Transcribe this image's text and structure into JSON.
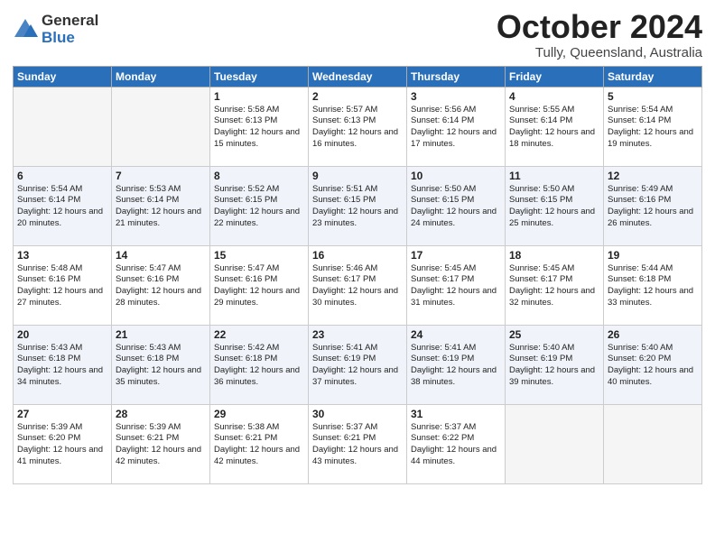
{
  "logo": {
    "general": "General",
    "blue": "Blue"
  },
  "title": "October 2024",
  "location": "Tully, Queensland, Australia",
  "days_of_week": [
    "Sunday",
    "Monday",
    "Tuesday",
    "Wednesday",
    "Thursday",
    "Friday",
    "Saturday"
  ],
  "weeks": [
    [
      {
        "day": "",
        "info": ""
      },
      {
        "day": "",
        "info": ""
      },
      {
        "day": "1",
        "info": "Sunrise: 5:58 AM\nSunset: 6:13 PM\nDaylight: 12 hours and 15 minutes."
      },
      {
        "day": "2",
        "info": "Sunrise: 5:57 AM\nSunset: 6:13 PM\nDaylight: 12 hours and 16 minutes."
      },
      {
        "day": "3",
        "info": "Sunrise: 5:56 AM\nSunset: 6:14 PM\nDaylight: 12 hours and 17 minutes."
      },
      {
        "day": "4",
        "info": "Sunrise: 5:55 AM\nSunset: 6:14 PM\nDaylight: 12 hours and 18 minutes."
      },
      {
        "day": "5",
        "info": "Sunrise: 5:54 AM\nSunset: 6:14 PM\nDaylight: 12 hours and 19 minutes."
      }
    ],
    [
      {
        "day": "6",
        "info": "Sunrise: 5:54 AM\nSunset: 6:14 PM\nDaylight: 12 hours and 20 minutes."
      },
      {
        "day": "7",
        "info": "Sunrise: 5:53 AM\nSunset: 6:14 PM\nDaylight: 12 hours and 21 minutes."
      },
      {
        "day": "8",
        "info": "Sunrise: 5:52 AM\nSunset: 6:15 PM\nDaylight: 12 hours and 22 minutes."
      },
      {
        "day": "9",
        "info": "Sunrise: 5:51 AM\nSunset: 6:15 PM\nDaylight: 12 hours and 23 minutes."
      },
      {
        "day": "10",
        "info": "Sunrise: 5:50 AM\nSunset: 6:15 PM\nDaylight: 12 hours and 24 minutes."
      },
      {
        "day": "11",
        "info": "Sunrise: 5:50 AM\nSunset: 6:15 PM\nDaylight: 12 hours and 25 minutes."
      },
      {
        "day": "12",
        "info": "Sunrise: 5:49 AM\nSunset: 6:16 PM\nDaylight: 12 hours and 26 minutes."
      }
    ],
    [
      {
        "day": "13",
        "info": "Sunrise: 5:48 AM\nSunset: 6:16 PM\nDaylight: 12 hours and 27 minutes."
      },
      {
        "day": "14",
        "info": "Sunrise: 5:47 AM\nSunset: 6:16 PM\nDaylight: 12 hours and 28 minutes."
      },
      {
        "day": "15",
        "info": "Sunrise: 5:47 AM\nSunset: 6:16 PM\nDaylight: 12 hours and 29 minutes."
      },
      {
        "day": "16",
        "info": "Sunrise: 5:46 AM\nSunset: 6:17 PM\nDaylight: 12 hours and 30 minutes."
      },
      {
        "day": "17",
        "info": "Sunrise: 5:45 AM\nSunset: 6:17 PM\nDaylight: 12 hours and 31 minutes."
      },
      {
        "day": "18",
        "info": "Sunrise: 5:45 AM\nSunset: 6:17 PM\nDaylight: 12 hours and 32 minutes."
      },
      {
        "day": "19",
        "info": "Sunrise: 5:44 AM\nSunset: 6:18 PM\nDaylight: 12 hours and 33 minutes."
      }
    ],
    [
      {
        "day": "20",
        "info": "Sunrise: 5:43 AM\nSunset: 6:18 PM\nDaylight: 12 hours and 34 minutes."
      },
      {
        "day": "21",
        "info": "Sunrise: 5:43 AM\nSunset: 6:18 PM\nDaylight: 12 hours and 35 minutes."
      },
      {
        "day": "22",
        "info": "Sunrise: 5:42 AM\nSunset: 6:18 PM\nDaylight: 12 hours and 36 minutes."
      },
      {
        "day": "23",
        "info": "Sunrise: 5:41 AM\nSunset: 6:19 PM\nDaylight: 12 hours and 37 minutes."
      },
      {
        "day": "24",
        "info": "Sunrise: 5:41 AM\nSunset: 6:19 PM\nDaylight: 12 hours and 38 minutes."
      },
      {
        "day": "25",
        "info": "Sunrise: 5:40 AM\nSunset: 6:19 PM\nDaylight: 12 hours and 39 minutes."
      },
      {
        "day": "26",
        "info": "Sunrise: 5:40 AM\nSunset: 6:20 PM\nDaylight: 12 hours and 40 minutes."
      }
    ],
    [
      {
        "day": "27",
        "info": "Sunrise: 5:39 AM\nSunset: 6:20 PM\nDaylight: 12 hours and 41 minutes."
      },
      {
        "day": "28",
        "info": "Sunrise: 5:39 AM\nSunset: 6:21 PM\nDaylight: 12 hours and 42 minutes."
      },
      {
        "day": "29",
        "info": "Sunrise: 5:38 AM\nSunset: 6:21 PM\nDaylight: 12 hours and 42 minutes."
      },
      {
        "day": "30",
        "info": "Sunrise: 5:37 AM\nSunset: 6:21 PM\nDaylight: 12 hours and 43 minutes."
      },
      {
        "day": "31",
        "info": "Sunrise: 5:37 AM\nSunset: 6:22 PM\nDaylight: 12 hours and 44 minutes."
      },
      {
        "day": "",
        "info": ""
      },
      {
        "day": "",
        "info": ""
      }
    ]
  ]
}
